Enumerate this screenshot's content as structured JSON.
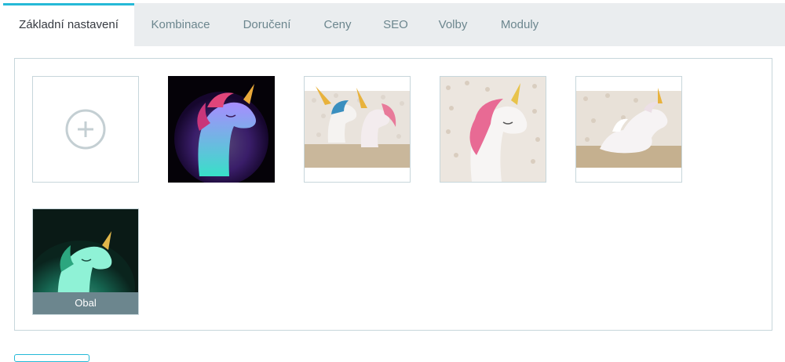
{
  "tabs": [
    {
      "label": "Základní nastavení",
      "active": true
    },
    {
      "label": "Kombinace"
    },
    {
      "label": "Doručení"
    },
    {
      "label": "Ceny"
    },
    {
      "label": "SEO"
    },
    {
      "label": "Volby"
    },
    {
      "label": "Moduly"
    }
  ],
  "images": {
    "add_icon": "plus-circle-icon",
    "cover_label": "Obal"
  },
  "colors": {
    "accent": "#25b9d7",
    "tab_bg": "#eaedef",
    "cover_bg": "#6c868e"
  }
}
